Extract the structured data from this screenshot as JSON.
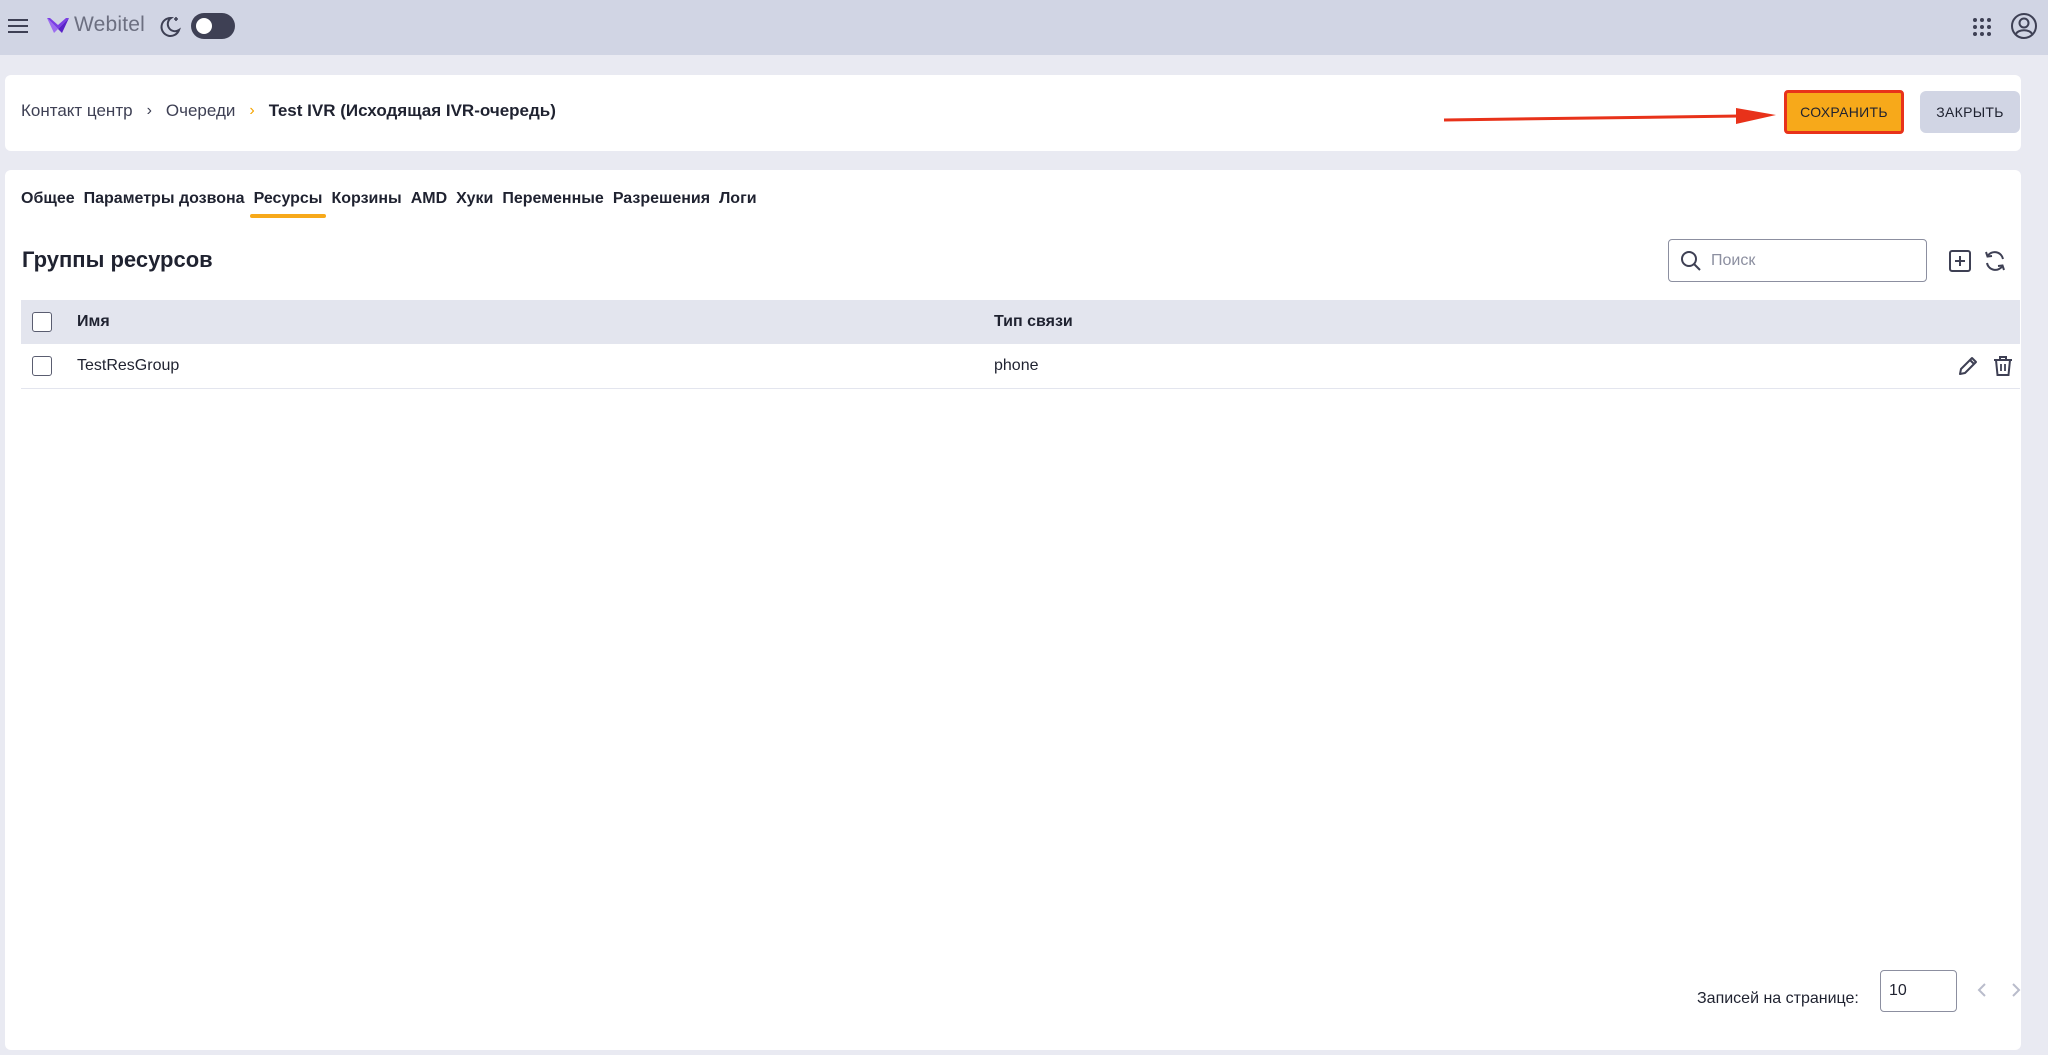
{
  "topbar": {
    "logo_text": "Webitel",
    "icons": [
      "menu-icon",
      "webitel-logo-icon",
      "moon-icon",
      "theme-toggle",
      "apps-grid-icon",
      "user-account-icon"
    ]
  },
  "breadcrumb": {
    "items": [
      "Контакт центр",
      "Очереди"
    ],
    "current": "Test IVR (Исходящая IVR-очередь)"
  },
  "actions": {
    "save_label": "СОХРАНИТЬ",
    "close_label": "ЗАКРЫТЬ"
  },
  "tabs": [
    {
      "label": "Общее",
      "active": false
    },
    {
      "label": "Параметры дозвона",
      "active": false
    },
    {
      "label": "Ресурсы",
      "active": true
    },
    {
      "label": "Корзины",
      "active": false
    },
    {
      "label": "AMD",
      "active": false
    },
    {
      "label": "Хуки",
      "active": false
    },
    {
      "label": "Переменные",
      "active": false
    },
    {
      "label": "Разрешения",
      "active": false
    },
    {
      "label": "Логи",
      "active": false
    }
  ],
  "section": {
    "title": "Группы ресурсов",
    "search_placeholder": "Поиск"
  },
  "table": {
    "columns": [
      "Имя",
      "Тип связи"
    ],
    "rows": [
      {
        "name": "TestResGroup",
        "type": "phone"
      }
    ]
  },
  "pagination": {
    "label": "Записей на странице:",
    "per_page": "10"
  },
  "colors": {
    "accent": "#f7a91a",
    "highlight_border": "#e8321a",
    "topbar_bg": "#d1d5e4"
  }
}
